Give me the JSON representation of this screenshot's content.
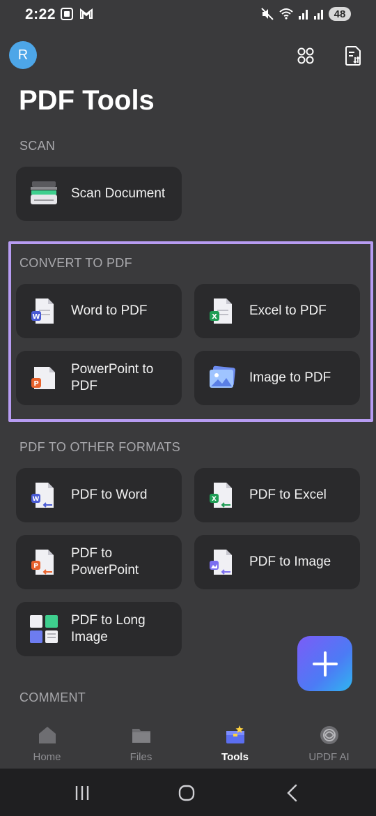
{
  "status_bar": {
    "time": "2:22",
    "battery": "48"
  },
  "header": {
    "avatar_initial": "R",
    "title": "PDF Tools"
  },
  "sections": {
    "scan": {
      "label": "SCAN",
      "items": [
        "Scan Document"
      ]
    },
    "convert_to_pdf": {
      "label": "CONVERT TO PDF",
      "items": [
        "Word to PDF",
        "Excel to PDF",
        "PowerPoint to PDF",
        "Image to PDF"
      ]
    },
    "pdf_to_other": {
      "label": "PDF TO OTHER FORMATS",
      "items": [
        "PDF to Word",
        "PDF to Excel",
        "PDF to PowerPoint",
        "PDF to Image",
        "PDF to Long Image"
      ]
    },
    "comment": {
      "label": "COMMENT"
    }
  },
  "bottom_nav": {
    "items": [
      {
        "label": "Home",
        "icon": "home-icon"
      },
      {
        "label": "Files",
        "icon": "folder-icon"
      },
      {
        "label": "Tools",
        "icon": "toolbox-icon"
      },
      {
        "label": "UPDF AI",
        "icon": "ai-icon"
      }
    ],
    "active": "Tools"
  },
  "colors": {
    "background": "#3a3a3c",
    "card": "#2a2a2c",
    "highlight": "#b79cf2",
    "avatar": "#4da6e8",
    "word": "#4a5bd4",
    "excel": "#1f9d55",
    "powerpoint": "#e8622c"
  }
}
